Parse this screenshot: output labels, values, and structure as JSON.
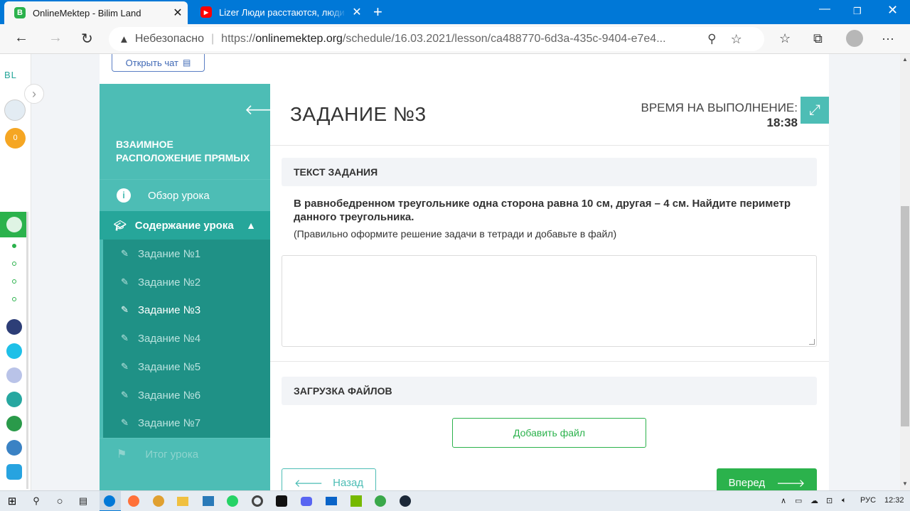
{
  "browser": {
    "tabs": [
      {
        "title": "OnlineMektep - Bilim Land",
        "favicon_color": "#2bb24c",
        "favicon_letter": "B"
      },
      {
        "title": "Lizer Люди расстаются, люди уходят",
        "favicon_color": "#ff0000",
        "favicon_letter": "▶"
      }
    ],
    "insecure_label": "Небезопасно",
    "url_prefix": "https://",
    "url_domain": "onlinemektep.org",
    "url_path": "/schedule/16.03.2021/lesson/ca488770-6d3a-435c-9404-e7e4..."
  },
  "leftbar": {
    "logo": "BL",
    "coins": "0"
  },
  "chat": {
    "label": "Открыть чат"
  },
  "sidebar": {
    "lesson_title": "ВЗАИМНОЕ РАСПОЛОЖЕНИЕ ПРЯМЫХ",
    "overview": "Обзор урока",
    "content": "Содержание урока",
    "items": [
      {
        "label": "Задание №1"
      },
      {
        "label": "Задание №2"
      },
      {
        "label": "Задание №3"
      },
      {
        "label": "Задание №4"
      },
      {
        "label": "Задание №5"
      },
      {
        "label": "Задание №6"
      },
      {
        "label": "Задание №7"
      }
    ],
    "current_index": 2,
    "summary": "Итог урока"
  },
  "main": {
    "task_title": "ЗАДАНИЕ №3",
    "timer_label": "ВРЕМЯ НА ВЫПОЛНЕНИЕ:",
    "timer_value": "18:38",
    "text_section": "ТЕКСТ ЗАДАНИЯ",
    "task_text": "В равнобедренном треугольнике одна сторона равна 10 см, другая – 4 см. Найдите периметр данного треугольника.",
    "task_note": "(Правильно оформите решение задачи в тетради и добавьте в файл)",
    "answer_value": "",
    "upload_section": "ЗАГРУЗКА ФАЙЛОВ",
    "add_file": "Добавить файл",
    "back": "Назад",
    "next": "Вперед"
  },
  "taskbar": {
    "lang": "РУС",
    "time": "12:32"
  },
  "colors": {
    "teal": "#4dbdb5",
    "teal_dark": "#26a69a",
    "green": "#2bb24c",
    "browser_blue": "#0078d7"
  }
}
